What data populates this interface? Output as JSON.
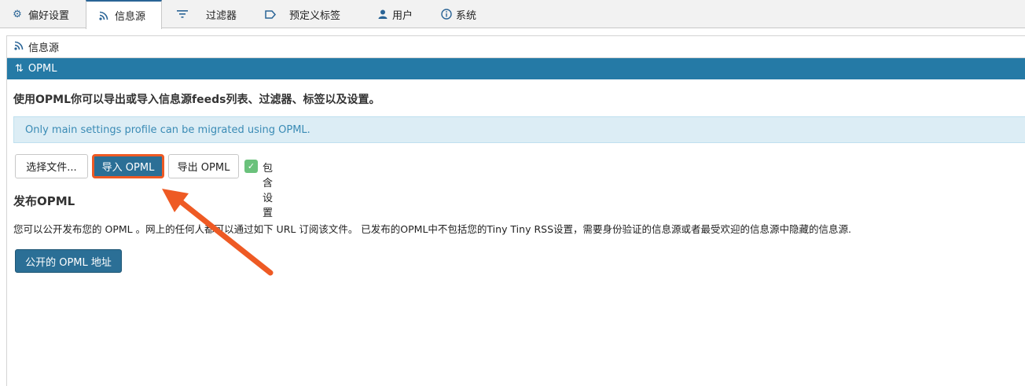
{
  "tabs": [
    {
      "label": "偏好设置",
      "icon": "gear-icon"
    },
    {
      "label": "信息源",
      "icon": "rss-icon"
    },
    {
      "label": "过滤器",
      "icon": "filter-icon"
    },
    {
      "label": "预定义标签",
      "icon": "label-icon"
    },
    {
      "label": "用户",
      "icon": "user-icon"
    },
    {
      "label": "系统",
      "icon": "info-icon"
    }
  ],
  "panel": {
    "title": "信息源",
    "section_title": "OPML",
    "intro": "使用OPML你可以导出或导入信息源feeds列表、过滤器、标签以及设置。",
    "notice": "Only main settings profile can be migrated using OPML.",
    "buttons": {
      "choose_file": "选择文件...",
      "import_opml": "导入 OPML",
      "export_opml": "导出 OPML",
      "include_settings": "包含设置"
    },
    "publish_title": "发布OPML",
    "publish_desc": "您可以公开发布您的 OPML 。网上的任何人都可以通过如下 URL 订阅该文件。 已发布的OPML中不包括您的Tiny Tiny RSS设置，需要身份验证的信息源或者最受欢迎的信息源中隐藏的信息源.",
    "public_url_button": "公开的 OPML 地址"
  },
  "colors": {
    "accent": "#257aa6",
    "highlight": "#ee5a24",
    "notice_bg": "#dcedf5",
    "check": "#6ac17b"
  }
}
